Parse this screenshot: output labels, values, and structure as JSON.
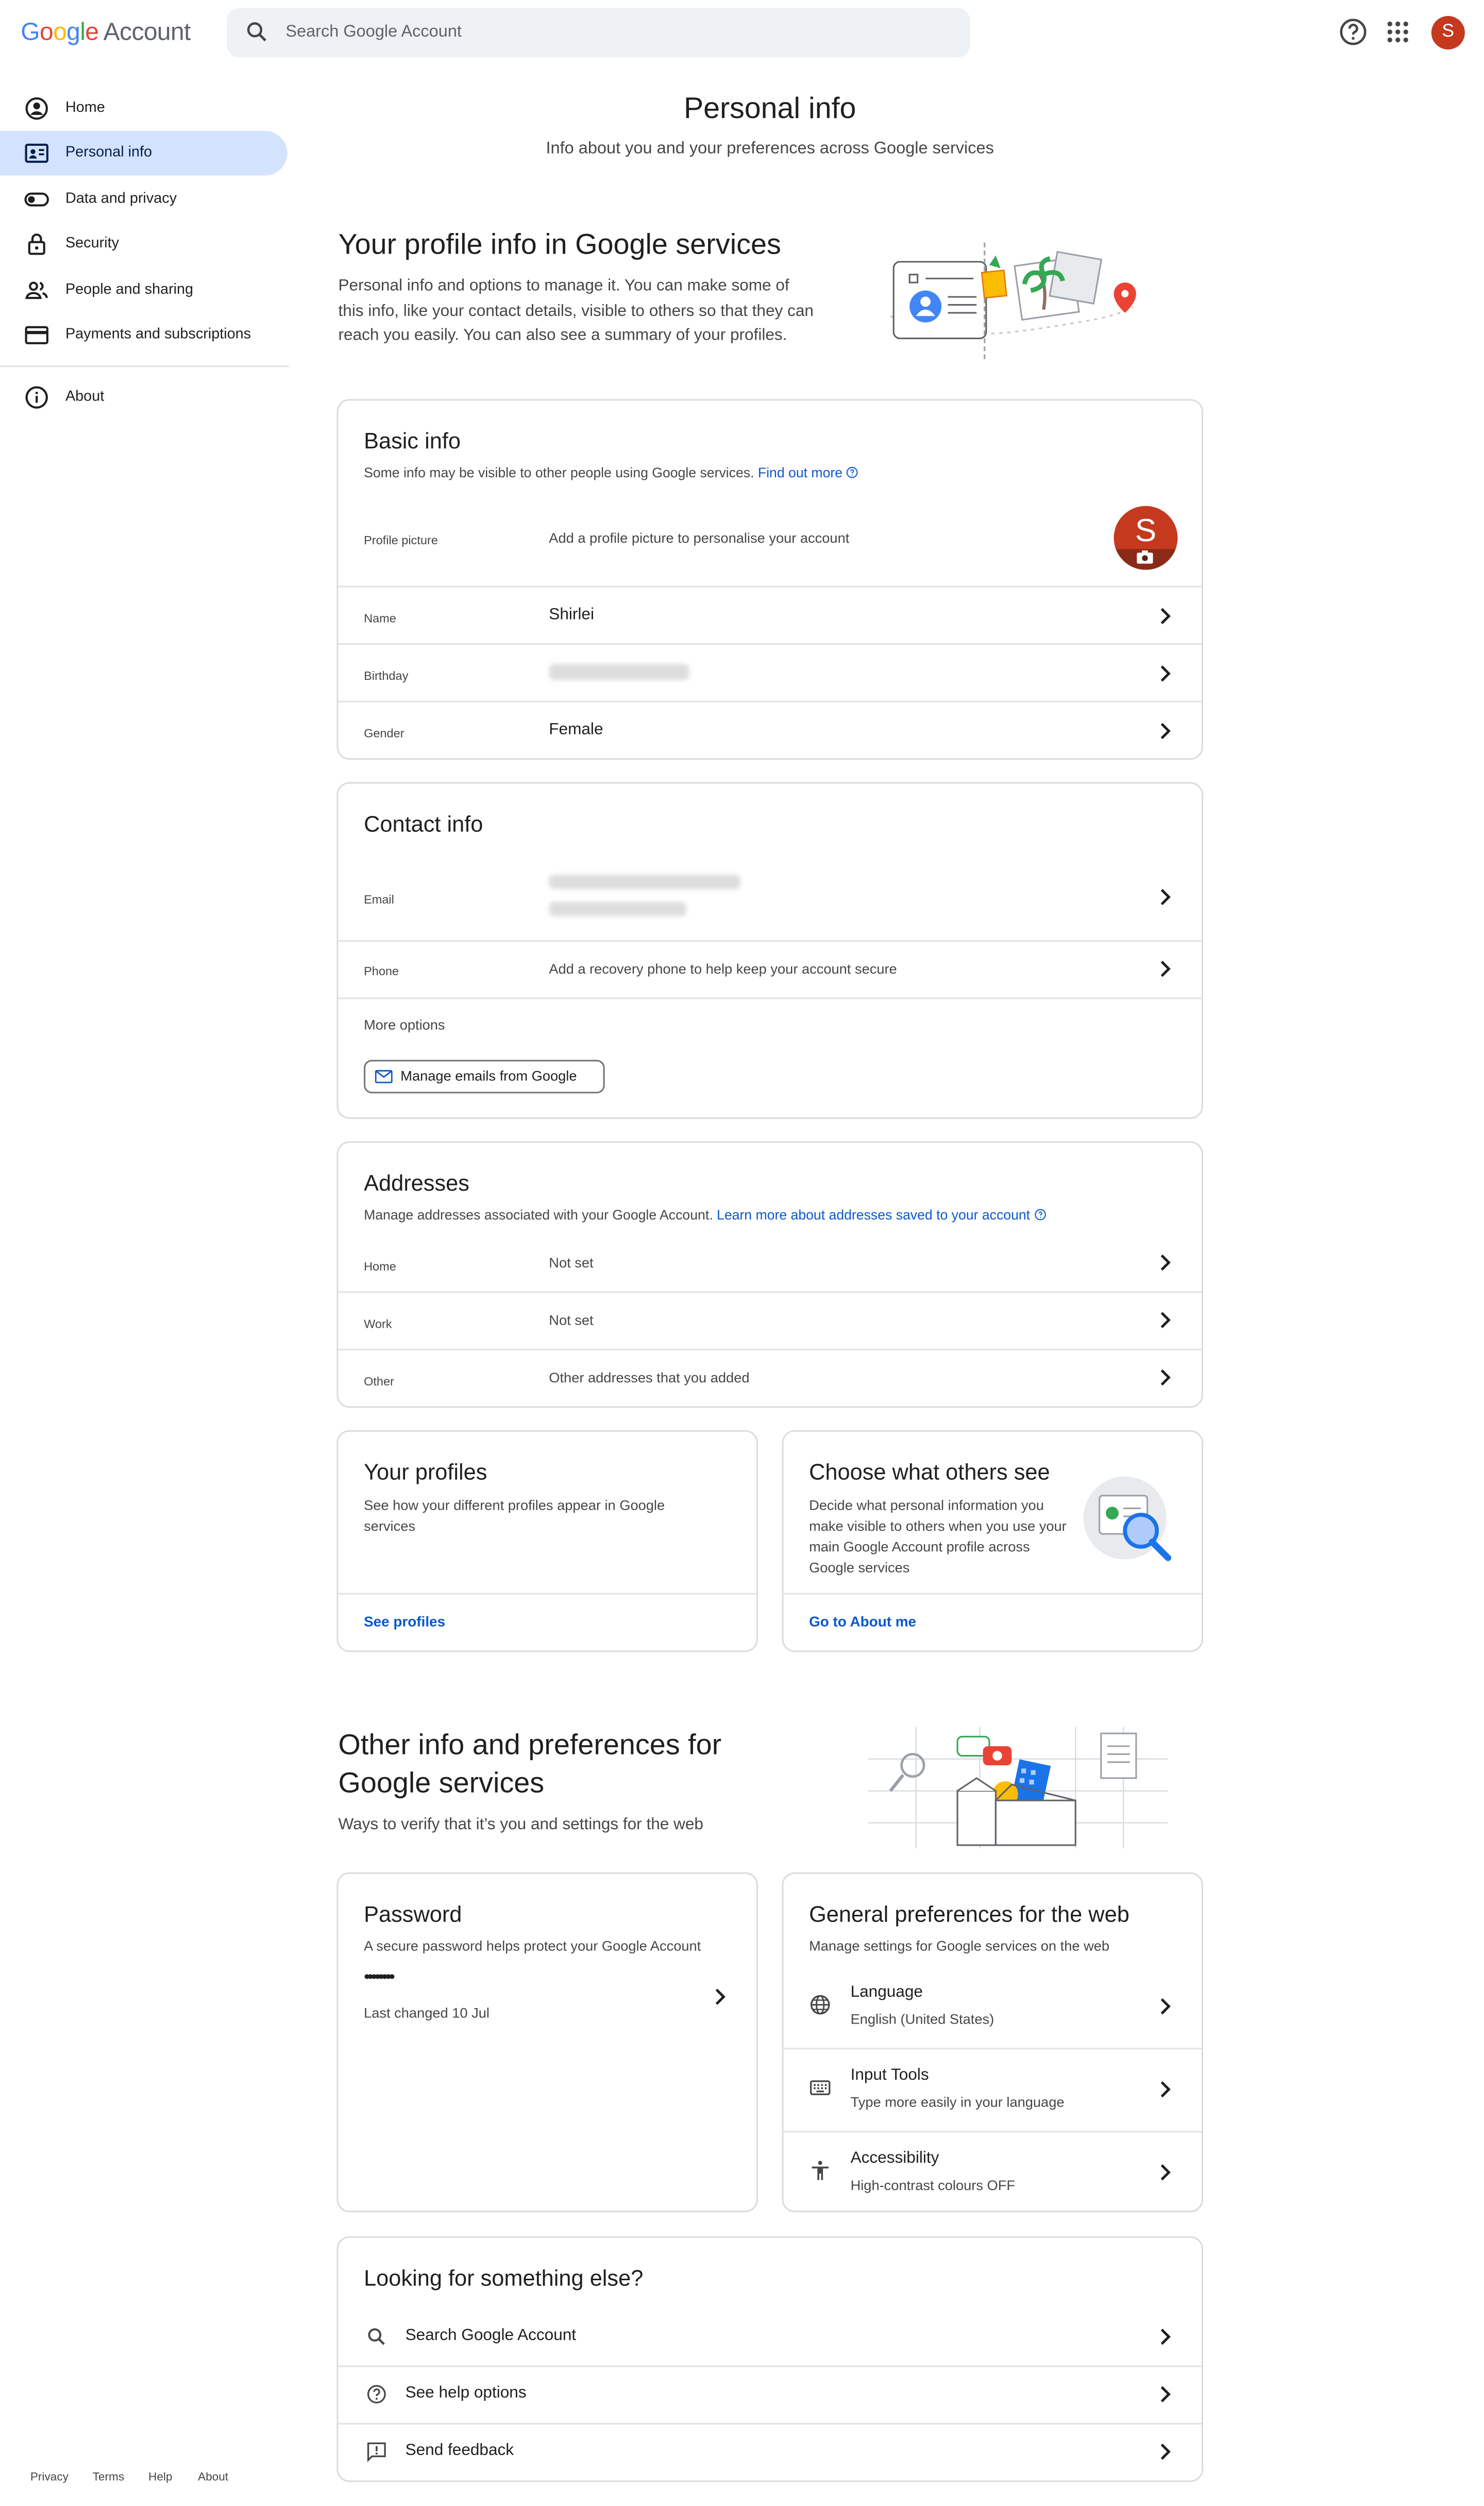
{
  "header": {
    "logo_parts": [
      "G",
      "o",
      "o",
      "g",
      "l",
      "e"
    ],
    "logo_suffix": "Account",
    "search_placeholder": "Search Google Account",
    "avatar_letter": "S"
  },
  "sidebar": {
    "items": [
      {
        "label": "Home",
        "icon": "account-circle-icon"
      },
      {
        "label": "Personal info",
        "icon": "id-card-icon",
        "active": true
      },
      {
        "label": "Data and privacy",
        "icon": "toggle-icon"
      },
      {
        "label": "Security",
        "icon": "lock-icon"
      },
      {
        "label": "People and sharing",
        "icon": "people-icon"
      },
      {
        "label": "Payments and subscriptions",
        "icon": "credit-card-icon"
      }
    ],
    "about": {
      "label": "About",
      "icon": "info-icon"
    }
  },
  "page": {
    "title": "Personal info",
    "subtitle": "Info about you and your preferences across Google services"
  },
  "profile_section": {
    "title": "Your profile info in Google services",
    "description": "Personal info and options to manage it. You can make some of this info, like your contact details, visible to others so that they can reach you easily. You can also see a summary of your profiles."
  },
  "basic_info": {
    "title": "Basic info",
    "note": "Some info may be visible to other people using Google services.",
    "note_link": "Find out more",
    "profile_picture_label": "Profile picture",
    "profile_picture_hint": "Add a profile picture to personalise your account",
    "avatar_letter": "S",
    "name_label": "Name",
    "name_value": "Shirlei",
    "birthday_label": "Birthday",
    "gender_label": "Gender",
    "gender_value": "Female"
  },
  "contact_info": {
    "title": "Contact info",
    "email_label": "Email",
    "phone_label": "Phone",
    "phone_hint": "Add a recovery phone to help keep your account secure",
    "more_options": "More options",
    "manage_emails_button": "Manage emails from Google"
  },
  "addresses": {
    "title": "Addresses",
    "note": "Manage addresses associated with your Google Account.",
    "note_link": "Learn more about addresses saved to your account",
    "rows": [
      {
        "label": "Home",
        "value": "Not set"
      },
      {
        "label": "Work",
        "value": "Not set"
      },
      {
        "label": "Other",
        "value": "Other addresses that you added"
      }
    ]
  },
  "your_profiles": {
    "title": "Your profiles",
    "description": "See how your different profiles appear in Google services",
    "link": "See profiles"
  },
  "choose_others": {
    "title": "Choose what others see",
    "description": "Decide what personal information you make visible to others when you use your main Google Account profile across Google services",
    "link": "Go to About me"
  },
  "other_section": {
    "title_line1": "Other info and preferences for",
    "title_line2": "Google services",
    "description": "Ways to verify that it’s you and settings for the web"
  },
  "password": {
    "title": "Password",
    "description": "A secure password helps protect your Google Account",
    "dots": "••••••••",
    "last_changed": "Last changed 10 Jul"
  },
  "web_prefs": {
    "title": "General preferences for the web",
    "description": "Manage settings for Google services on the web",
    "rows": [
      {
        "title": "Language",
        "value": "English (United States)",
        "icon": "globe-icon"
      },
      {
        "title": "Input Tools",
        "value": "Type more easily in your language",
        "icon": "keyboard-icon"
      },
      {
        "title": "Accessibility",
        "value": "High-contrast colours OFF",
        "icon": "accessibility-icon"
      }
    ]
  },
  "looking": {
    "title": "Looking for something else?",
    "rows": [
      {
        "label": "Search Google Account",
        "icon": "search-icon"
      },
      {
        "label": "See help options",
        "icon": "help-icon"
      },
      {
        "label": "Send feedback",
        "icon": "feedback-icon"
      }
    ]
  },
  "footer": {
    "links": [
      "Privacy",
      "Terms",
      "Help",
      "About"
    ]
  }
}
